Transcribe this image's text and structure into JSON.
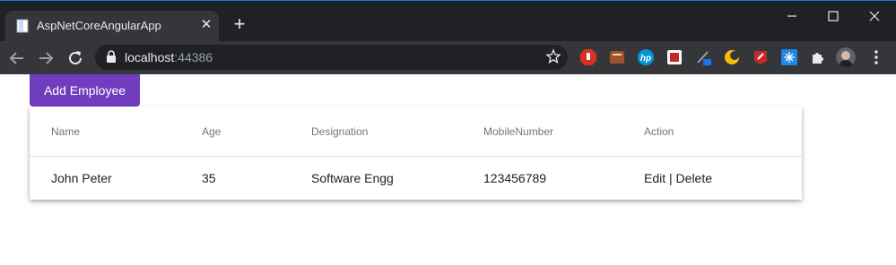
{
  "browser": {
    "tab": {
      "title": "AspNetCoreAngularApp"
    },
    "address": {
      "host": "localhost",
      "port": ":44386"
    }
  },
  "page": {
    "add_button_label": "Add Employee",
    "table": {
      "headers": [
        "Name",
        "Age",
        "Designation",
        "MobileNumber",
        "Action"
      ],
      "rows": [
        {
          "name": "John Peter",
          "age": "35",
          "designation": "Software Engg",
          "mobile": "123456789",
          "edit": "Edit",
          "separator": " | ",
          "delete": "Delete"
        }
      ]
    }
  }
}
